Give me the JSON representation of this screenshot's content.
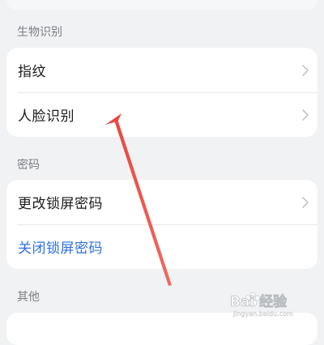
{
  "sections": [
    {
      "header": "生物识别",
      "rows": [
        {
          "label": "指纹",
          "chevron": true
        },
        {
          "label": "人脸识别",
          "chevron": true
        }
      ]
    },
    {
      "header": "密码",
      "rows": [
        {
          "label": "更改锁屏密码",
          "chevron": true
        },
        {
          "label": "关闭锁屏密码",
          "chevron": false
        }
      ]
    },
    {
      "header": "其他",
      "rows": []
    }
  ],
  "watermark": {
    "text": "Bai 经验",
    "sub": "jingyan.baidu.com"
  },
  "colors": {
    "background": "#f1f2f4",
    "card": "#ffffff",
    "link": "#2f6fe0",
    "annotation_arrow": "#e8463f"
  }
}
